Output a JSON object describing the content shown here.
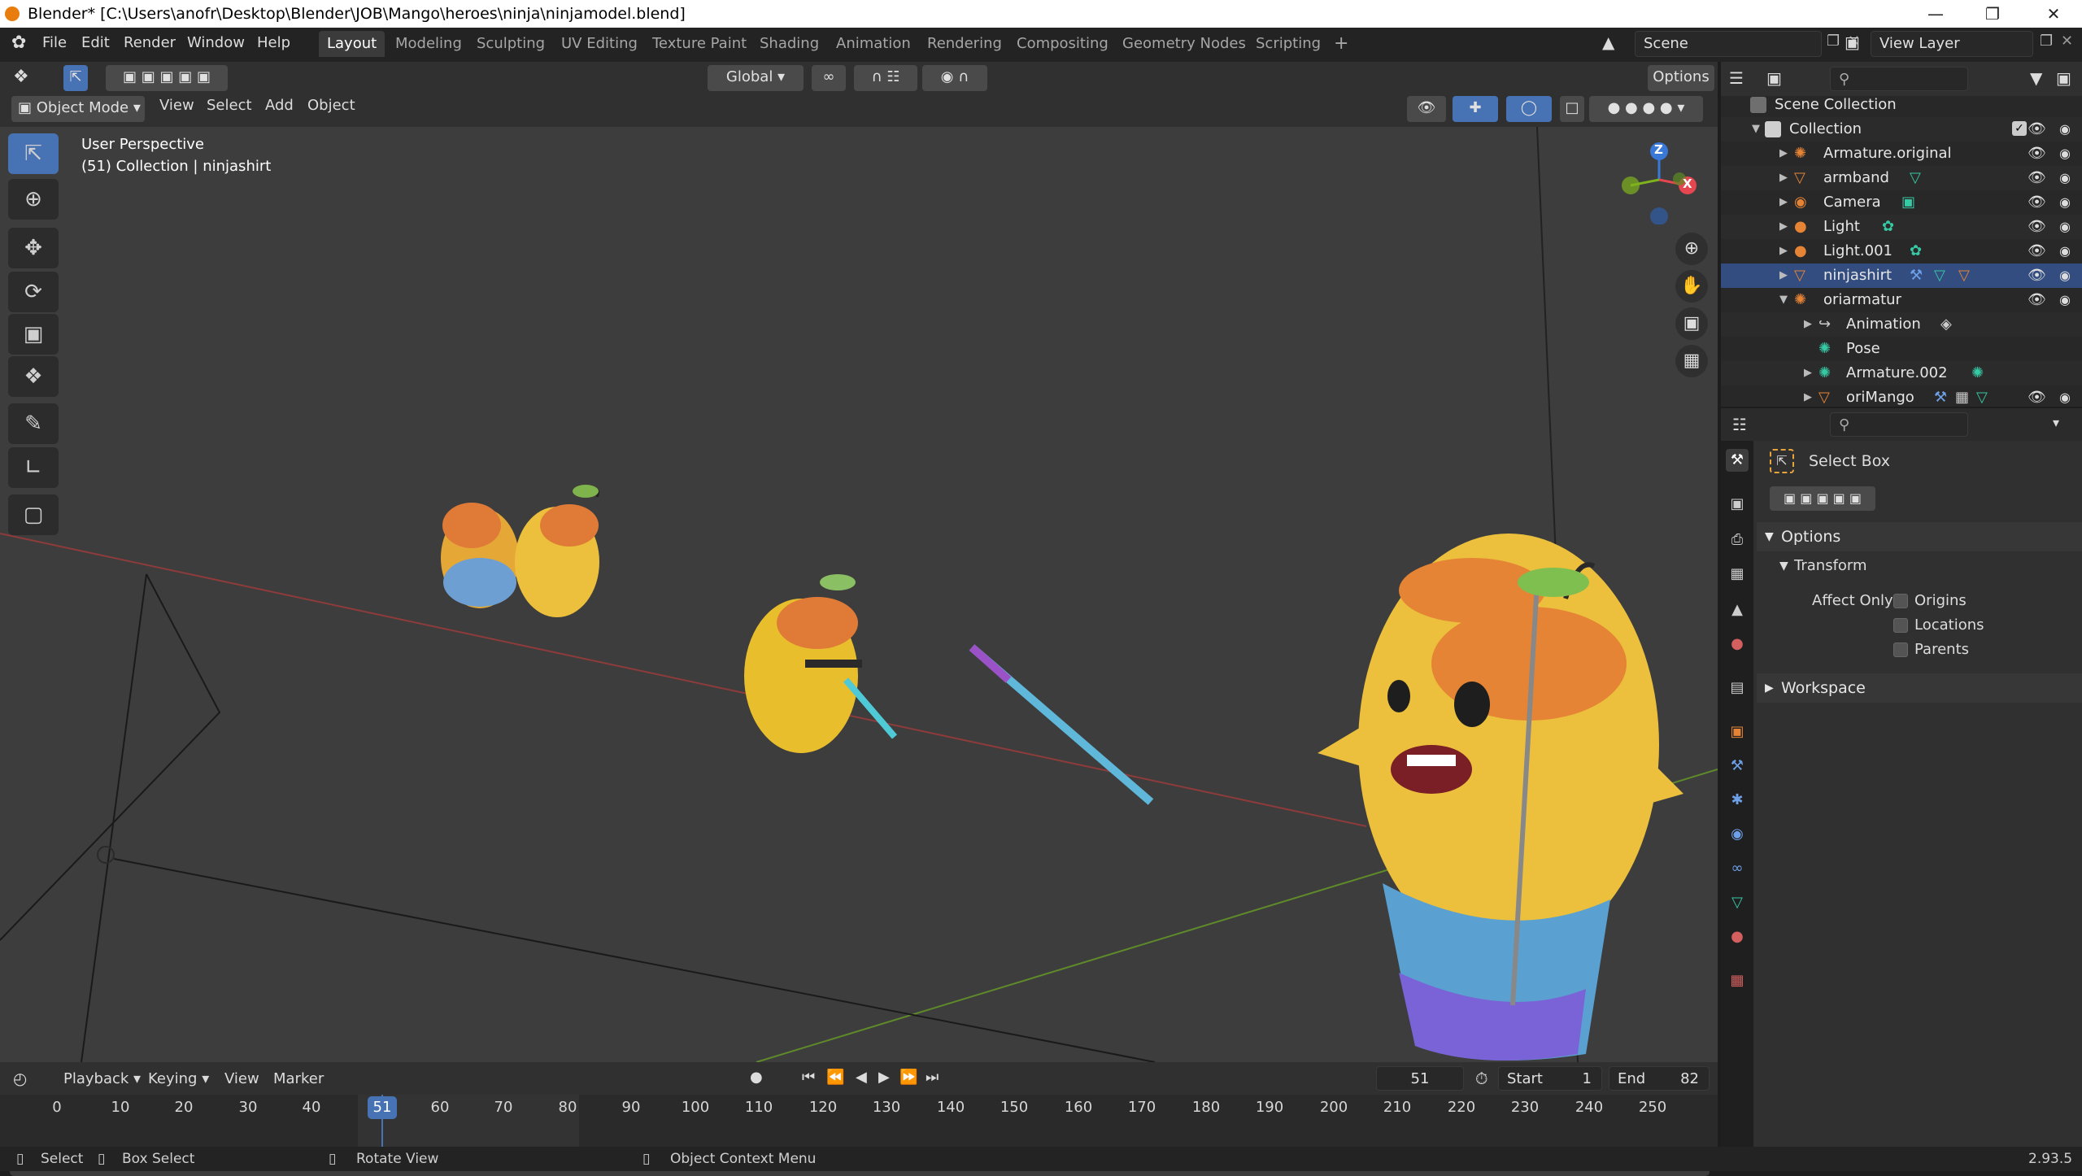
{
  "window": {
    "title": "Blender* [C:\\Users\\anofr\\Desktop\\Blender\\JOB\\Mango\\heroes\\ninja\\ninjamodel.blend]"
  },
  "menu": {
    "items": [
      "File",
      "Edit",
      "Render",
      "Window",
      "Help"
    ]
  },
  "workspaces": [
    "Layout",
    "Modeling",
    "Sculpting",
    "UV Editing",
    "Texture Paint",
    "Shading",
    "Animation",
    "Rendering",
    "Compositing",
    "Geometry Nodes",
    "Scripting"
  ],
  "scene": {
    "name": "Scene",
    "view_layer": "View Layer"
  },
  "viewport_header": {
    "transform_orientation": "Global",
    "options_label": "Options",
    "mode": "Object Mode",
    "menus": [
      "View",
      "Select",
      "Add",
      "Object"
    ]
  },
  "viewport": {
    "perspective": "User Perspective",
    "context": "(51) Collection | ninjashirt"
  },
  "gizmo": {
    "z": "Z",
    "x": "X"
  },
  "outliner": {
    "search_placeholder": "",
    "rows": [
      {
        "label": "Scene Collection",
        "icon": "scene-collection-icon"
      },
      {
        "label": "Collection",
        "icon": "collection-icon"
      },
      {
        "label": "Armature.original",
        "icon": "armature-icon"
      },
      {
        "label": "armband",
        "icon": "mesh-icon"
      },
      {
        "label": "Camera",
        "icon": "camera-icon"
      },
      {
        "label": "Light",
        "icon": "light-icon"
      },
      {
        "label": "Light.001",
        "icon": "light-icon"
      },
      {
        "label": "ninjashirt",
        "icon": "mesh-icon"
      },
      {
        "label": "oriarmatur",
        "icon": "armature-icon"
      },
      {
        "label": "Animation",
        "icon": "animation-icon"
      },
      {
        "label": "Pose",
        "icon": "pose-icon"
      },
      {
        "label": "Armature.002",
        "icon": "armature-data-icon"
      },
      {
        "label": "oriMango",
        "icon": "mesh-icon"
      }
    ]
  },
  "properties": {
    "tool_name": "Select Box",
    "panels": {
      "options": "Options",
      "transform": "Transform",
      "workspace": "Workspace"
    },
    "affect_only_label": "Affect Only",
    "checkboxes": [
      "Origins",
      "Locations",
      "Parents"
    ]
  },
  "timeline": {
    "menus": [
      "Playback",
      "Keying",
      "View",
      "Marker"
    ],
    "current_frame": "51",
    "start_label": "Start",
    "start": "1",
    "end_label": "End",
    "end": "82",
    "ticks": [
      "0",
      "10",
      "20",
      "30",
      "40",
      "51",
      "60",
      "70",
      "80",
      "90",
      "100",
      "110",
      "120",
      "130",
      "140",
      "150",
      "160",
      "170",
      "180",
      "190",
      "200",
      "210",
      "220",
      "230",
      "240",
      "250"
    ]
  },
  "statusbar": {
    "select": "Select",
    "box_select": "Box Select",
    "rotate_view": "Rotate View",
    "context_menu": "Object Context Menu",
    "version": "2.93.5"
  },
  "colors": {
    "accent": "#4772b3",
    "active_tool": "#4772b3",
    "x_axis": "#e5464f",
    "y_axis": "#7fb31d",
    "z_axis": "#3a78d8"
  }
}
